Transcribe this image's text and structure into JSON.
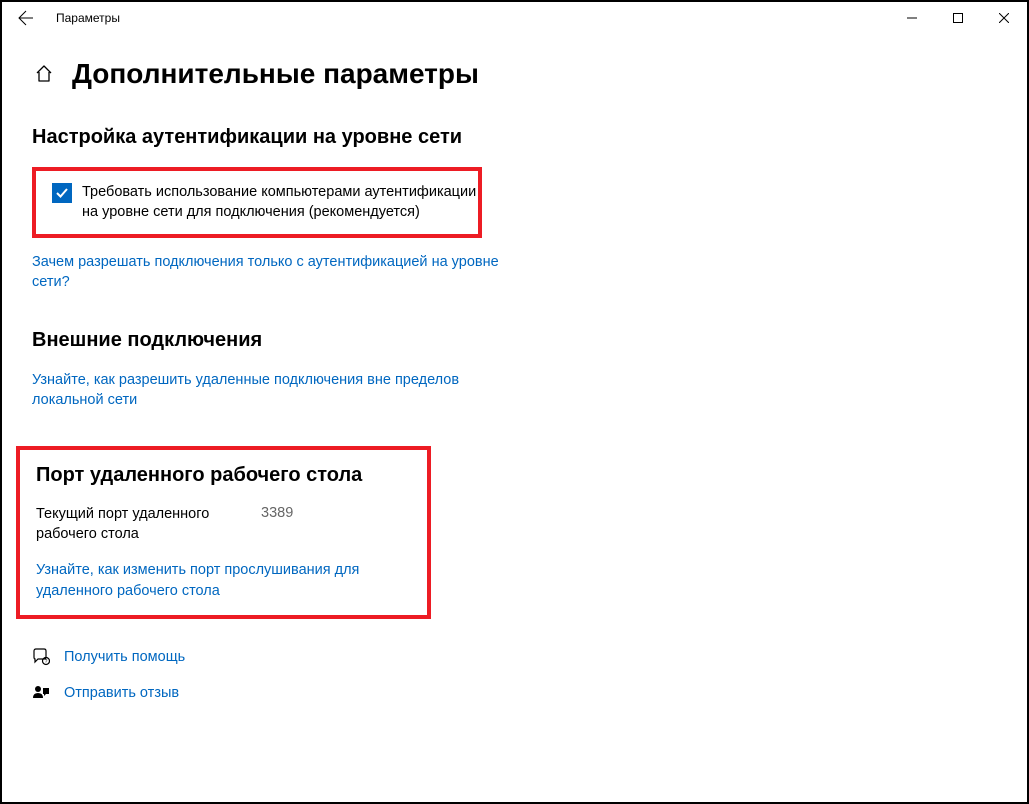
{
  "window": {
    "title": "Параметры"
  },
  "page": {
    "heading": "Дополнительные параметры"
  },
  "nla": {
    "heading": "Настройка аутентификации на уровне сети",
    "checkbox_label": "Требовать использование компьютерами аутентификации на уровне сети для подключения (рекомендуется)",
    "help_link": "Зачем разрешать подключения только с аутентификацией на уровне сети?"
  },
  "external": {
    "heading": "Внешние подключения",
    "help_link": "Узнайте, как разрешить удаленные подключения вне пределов локальной сети"
  },
  "port": {
    "heading": "Порт удаленного рабочего стола",
    "current_label": "Текущий порт удаленного рабочего стола",
    "current_value": "3389",
    "help_link": "Узнайте, как изменить порт прослушивания для удаленного рабочего стола"
  },
  "footer": {
    "get_help": "Получить помощь",
    "feedback": "Отправить отзыв"
  }
}
